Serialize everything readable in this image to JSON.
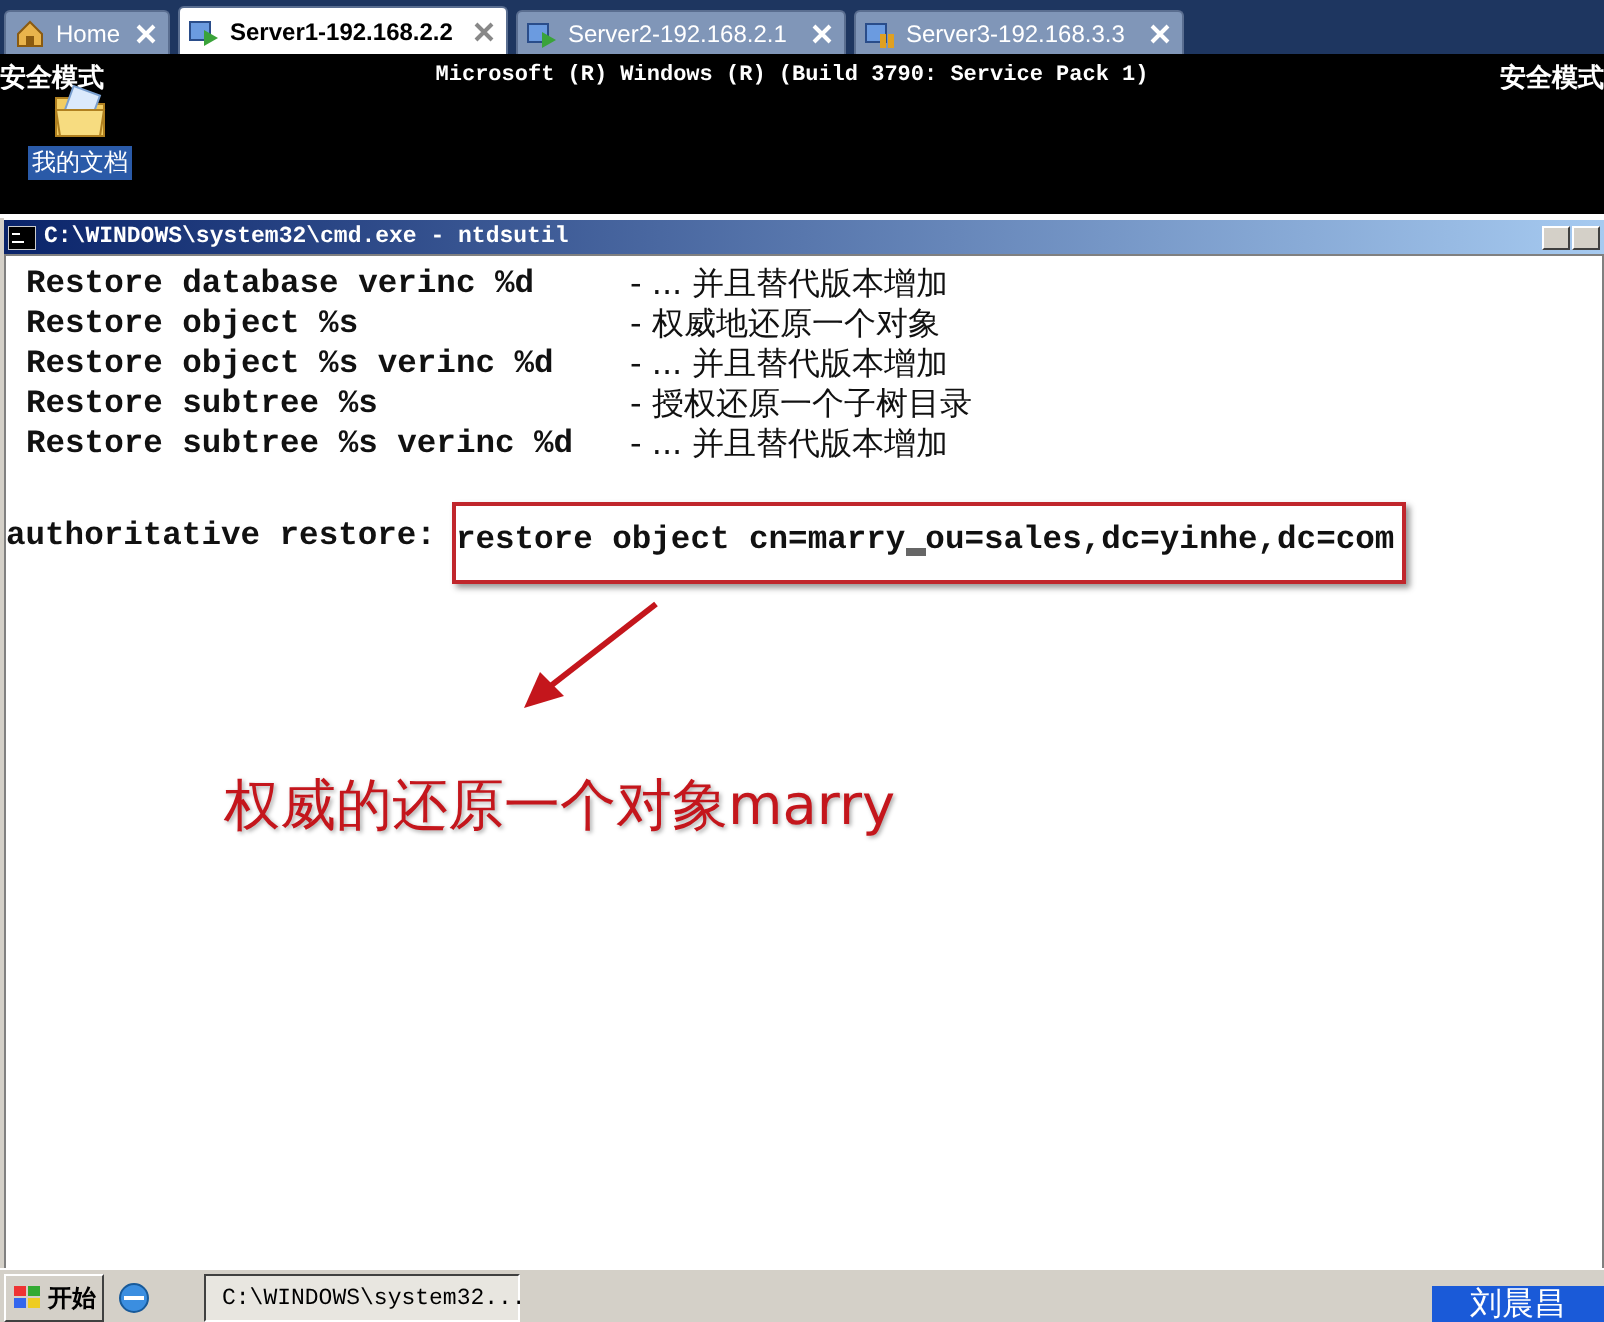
{
  "tabs": [
    {
      "label": "Home",
      "kind": "home",
      "selected": false
    },
    {
      "label": "Server1-192.168.2.2",
      "kind": "vm",
      "selected": true
    },
    {
      "label": "Server2-192.168.2.1",
      "kind": "vm",
      "selected": false
    },
    {
      "label": "Server3-192.168.3.3",
      "kind": "vm-paused",
      "selected": false
    }
  ],
  "desktop": {
    "mode_left": "安全模式",
    "banner": "Microsoft (R) Windows (R) (Build 3790: Service Pack 1)",
    "mode_right": "安全模式",
    "icon_label": "我的文档"
  },
  "console": {
    "title": "C:\\WINDOWS\\system32\\cmd.exe - ntdsutil",
    "lines": [
      {
        "command": "Restore database verinc %d",
        "description": "- ... 并且替代版本增加"
      },
      {
        "command": "Restore object %s",
        "description": "- 权威地还原一个对象"
      },
      {
        "command": "Restore object %s verinc %d",
        "description": "- ... 并且替代版本增加"
      },
      {
        "command": "Restore subtree %s",
        "description": "- 授权还原一个子树目录"
      },
      {
        "command": "Restore subtree %s verinc %d",
        "description": "- ... 并且替代版本增加"
      }
    ],
    "prompt": "authoritative restore:",
    "input_before_cursor": "restore object cn=marry",
    "input_after_cursor": "ou=sales,dc=yinhe,dc=com",
    "annotation": "权威的还原一个对象marry"
  },
  "taskbar": {
    "start": "开始",
    "task": "C:\\WINDOWS\\system32...",
    "user": "刘晨昌"
  }
}
